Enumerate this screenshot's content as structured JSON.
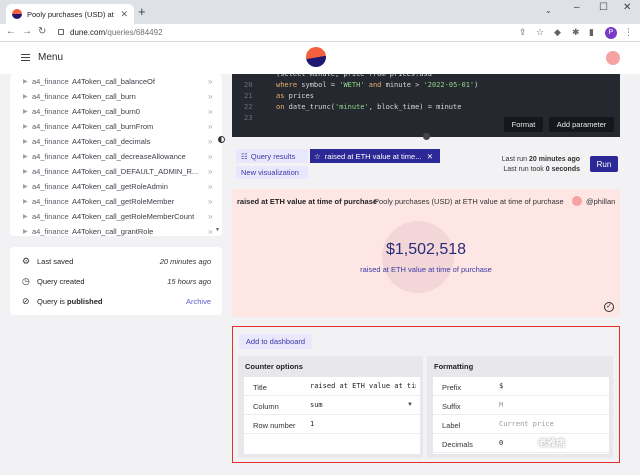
{
  "browser": {
    "tab_title": "Pooly purchases (USD) at ETH va",
    "url_host": "dune.com",
    "url_path": "/queries/684492",
    "profile_initial": "P"
  },
  "header": {
    "menu_label": "Menu"
  },
  "sidebar": {
    "namespace": "a4_finance",
    "tables": [
      "A4Token_call_balanceOf",
      "A4Token_call_burn",
      "A4Token_call_burn0",
      "A4Token_call_burnFrom",
      "A4Token_call_decimals",
      "A4Token_call_decreaseAllowance",
      "A4Token_call_DEFAULT_ADMIN_R...",
      "A4Token_call_getRoleAdmin",
      "A4Token_call_getRoleMember",
      "A4Token_call_getRoleMemberCount",
      "A4Token_call_grantRole"
    ]
  },
  "meta": {
    "last_saved_label": "Last saved",
    "last_saved_value": "20 minutes ago",
    "created_label": "Query created",
    "created_value": "15 hours ago",
    "published_prefix": "Query is",
    "published_word": "published",
    "archive_label": "Archive"
  },
  "editor": {
    "lines": [
      {
        "n": "",
        "parts": [
          [
            "",
            "(select minute, price from prices.usd"
          ]
        ]
      },
      {
        "n": "20",
        "parts": [
          [
            "kw",
            "where"
          ],
          [
            "",
            " symbol = "
          ],
          [
            "str",
            "'WETH'"
          ],
          [
            "",
            " "
          ],
          [
            "kw",
            "and"
          ],
          [
            "",
            " minute > "
          ],
          [
            "str",
            "'2022-05-01'"
          ],
          [
            "",
            ")"
          ]
        ]
      },
      {
        "n": "21",
        "parts": [
          [
            "kw",
            "as"
          ],
          [
            "",
            " prices"
          ]
        ]
      },
      {
        "n": "22",
        "parts": [
          [
            "kw",
            "on"
          ],
          [
            "",
            " date_trunc("
          ],
          [
            "str",
            "'minute'"
          ],
          [
            "",
            ", block_time) = minute"
          ]
        ]
      },
      {
        "n": "23",
        "parts": [
          [
            "",
            ""
          ]
        ]
      }
    ],
    "format_label": "Format",
    "add_param_label": "Add parameter"
  },
  "tabs": {
    "results_label": "Query results",
    "viz_label": "raised at ETH value at time...",
    "new_viz_label": "New visualization"
  },
  "run": {
    "last_run_prefix": "Last run",
    "last_run_value": "20 minutes ago",
    "took_prefix": "Last run took",
    "took_value": "0 seconds",
    "run_label": "Run"
  },
  "viz": {
    "title": "raised at ETH value at time of purchase",
    "query_name": "Pooly purchases (USD) at ETH value at time of purchase",
    "user": "@phillan",
    "value": "$1,502,518",
    "label": "raised at ETH value at time of purchase"
  },
  "options": {
    "add_dashboard_label": "Add to dashboard",
    "counter_heading": "Counter options",
    "counter_fields": [
      {
        "label": "Title",
        "value": "raised at ETH value at time of purchase"
      },
      {
        "label": "Column",
        "value": "sum"
      },
      {
        "label": "Row number",
        "value": "1"
      }
    ],
    "format_heading": "Formatting",
    "format_fields": [
      {
        "label": "Prefix",
        "value": "$"
      },
      {
        "label": "Suffix",
        "value": "M"
      },
      {
        "label": "Label",
        "value": "Current price"
      },
      {
        "label": "Decimals",
        "value": "0"
      }
    ]
  },
  "watermark": "老雅痞",
  "colors": {
    "brand_purple": "#2c2895",
    "accent_light": "#e9e7fb",
    "viz_background": "#fde6e4",
    "highlight_border": "#e5302a"
  }
}
